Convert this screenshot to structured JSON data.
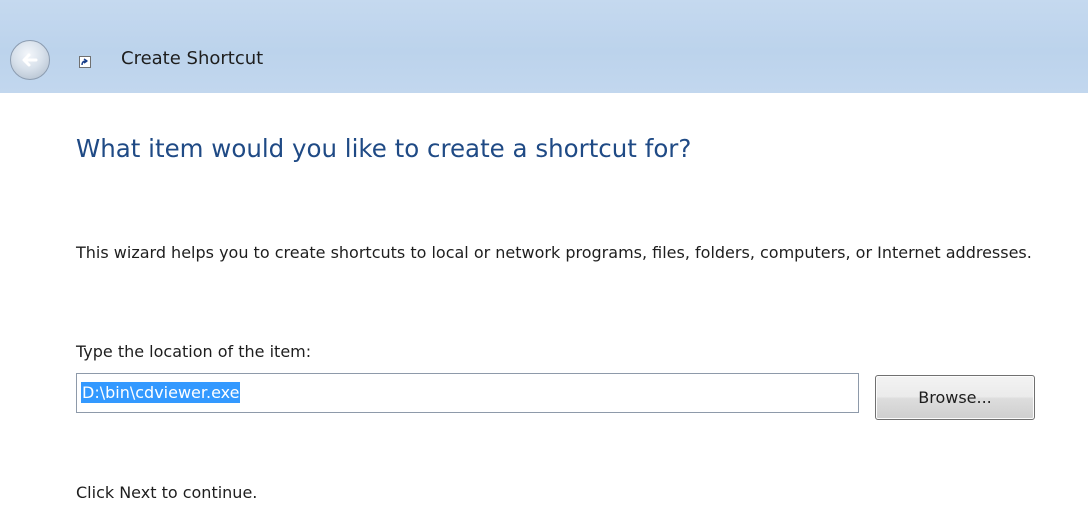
{
  "window": {
    "title": "Create Shortcut",
    "back_icon": "back-arrow-icon",
    "app_icon": "shortcut-icon"
  },
  "content": {
    "heading": "What item would you like to create a shortcut for?",
    "description": "This wizard helps you to create shortcuts to local or network programs, files, folders, computers, or Internet addresses.",
    "location_label": "Type the location of the item:",
    "location_value": "D:\\bin\\cdviewer.exe",
    "browse_label": "Browse...",
    "next_hint": "Click Next to continue."
  },
  "colors": {
    "title_bar": "#c5d9ef",
    "heading": "#1f4a85",
    "selection": "#3399ff"
  }
}
